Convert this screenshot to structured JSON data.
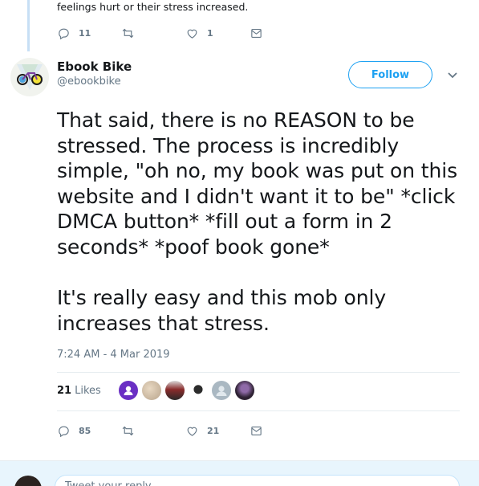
{
  "previous_tweet": {
    "text": "feelings hurt or their stress increased.",
    "actions": {
      "replies": "11",
      "retweets": "",
      "likes": "1"
    }
  },
  "author": {
    "name": "Ebook Bike",
    "handle": "@ebookbike",
    "follow_label": "Follow"
  },
  "tweet": {
    "paragraph1": "That said, there is no REASON to be stressed. The process is incredibly simple, \"oh no, my book was put on this website and I didn't want it to be\" *click DMCA button* *fill out a form in 2 seconds* *poof book gone*",
    "paragraph2": "It's really easy and this mob only increases that stress.",
    "timestamp": "7:24 AM - 4 Mar 2019"
  },
  "stats": {
    "likes_count": "21",
    "likes_label": "Likes"
  },
  "actions": {
    "replies": "85",
    "retweets": "",
    "likes": "21"
  },
  "reply": {
    "placeholder": "Tweet your reply"
  },
  "colors": {
    "accent": "#1da1f2",
    "muted": "#657786",
    "thread_line": "#c7dff5"
  }
}
